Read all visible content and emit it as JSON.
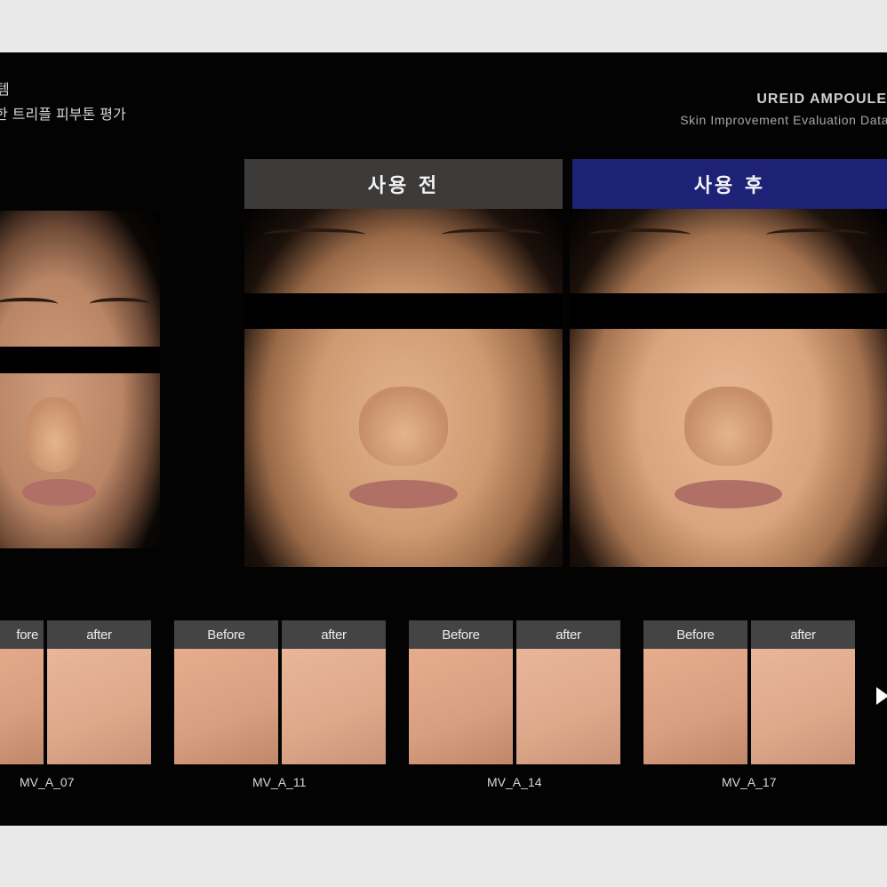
{
  "header": {
    "kr_line1": "템",
    "kr_line2": "한 트리플 피부톤 평가",
    "brand_name": "UREID AMPOULE",
    "brand_sub": "Skin Improvement Evaluation Data"
  },
  "comparison": {
    "before_label": "사용 전",
    "after_label": "사용 후"
  },
  "thumbnails": [
    {
      "before": "fore",
      "after": "after",
      "code": "MV_A_07"
    },
    {
      "before": "Before",
      "after": "after",
      "code": "MV_A_11"
    },
    {
      "before": "Before",
      "after": "after",
      "code": "MV_A_14"
    },
    {
      "before": "Before",
      "after": "after",
      "code": "MV_A_17"
    }
  ],
  "icons": {
    "next": "play-arrow-icon"
  },
  "colors": {
    "stage_bg": "#030303",
    "before_header": "#3d3b3a",
    "after_header": "#1e2276",
    "label_bg": "#444444"
  }
}
